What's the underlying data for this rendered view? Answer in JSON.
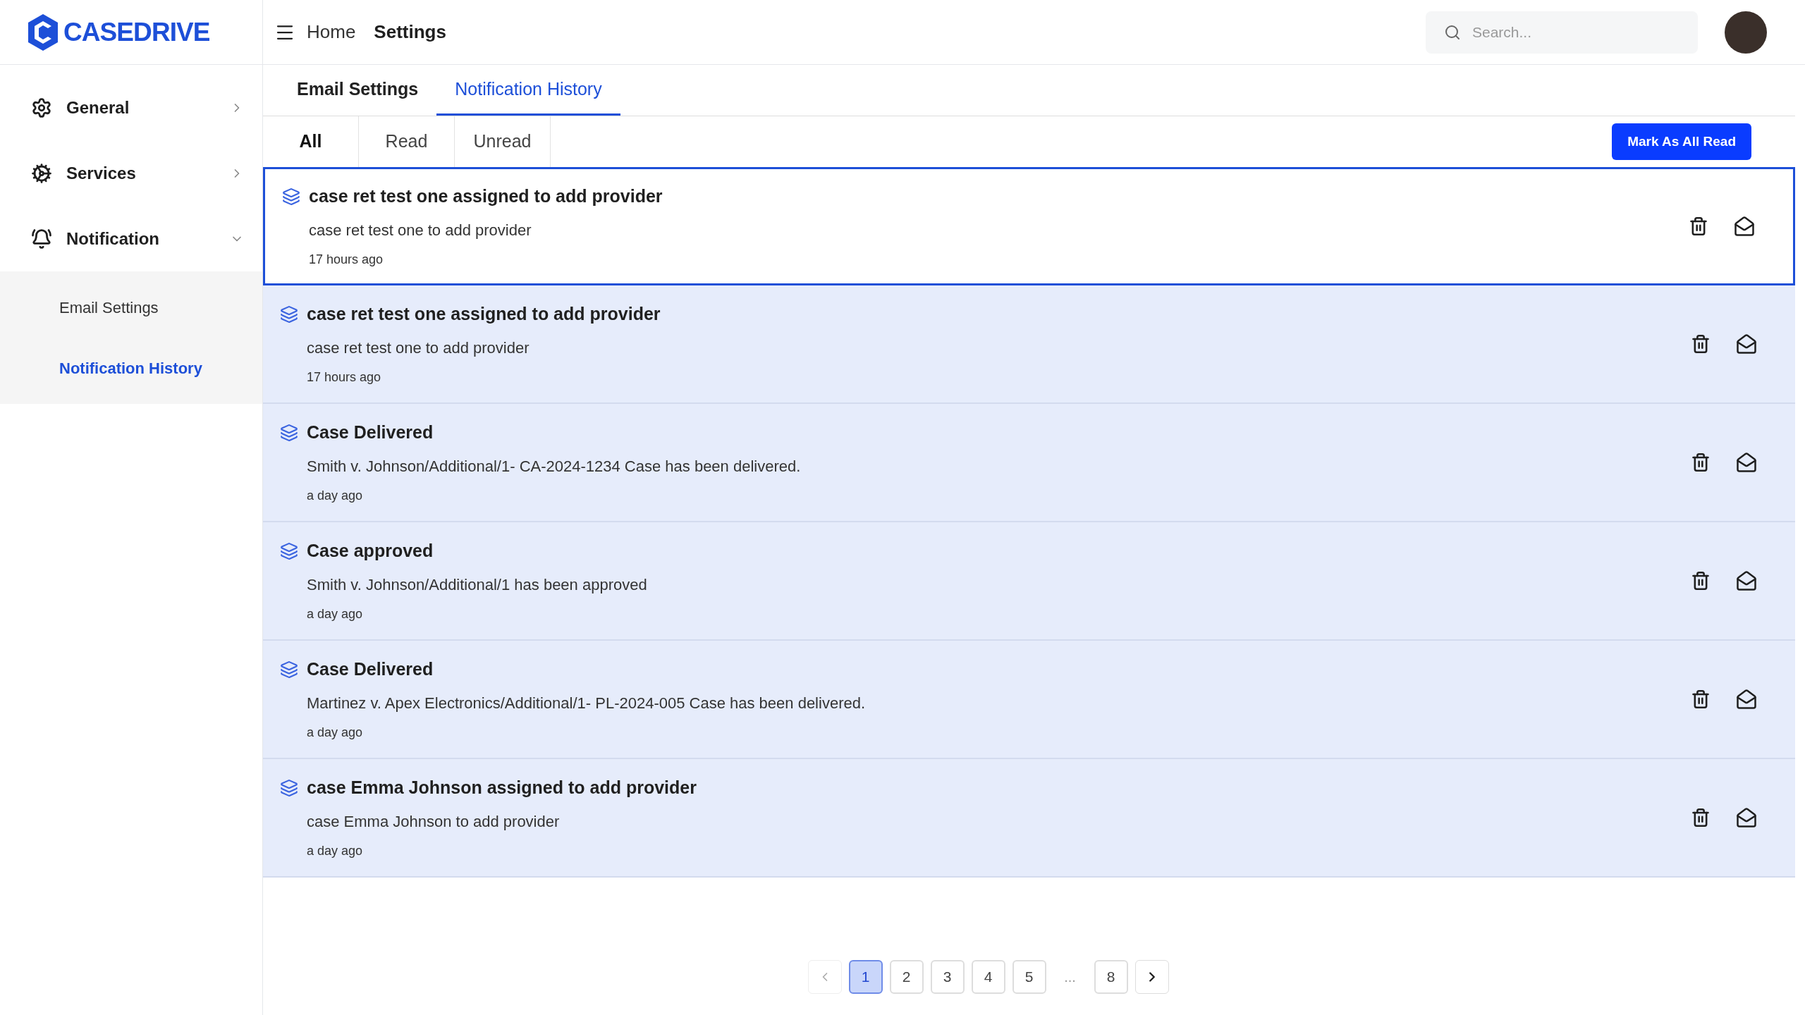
{
  "logo": {
    "text": "CASEDRIVE"
  },
  "sidebar": {
    "items": [
      {
        "label": "General",
        "kind": "gear",
        "expanded": false
      },
      {
        "label": "Services",
        "kind": "cog",
        "expanded": false
      },
      {
        "label": "Notification",
        "kind": "bell",
        "expanded": true,
        "children": [
          {
            "label": "Email Settings",
            "selected": false
          },
          {
            "label": "Notification History",
            "selected": true
          }
        ]
      }
    ]
  },
  "header": {
    "breadcrumb": [
      "Home",
      "Settings"
    ],
    "search": {
      "placeholder": "Search..."
    }
  },
  "tabs": [
    {
      "label": "Email Settings",
      "selected": false
    },
    {
      "label": "Notification History",
      "selected": true
    }
  ],
  "filters": [
    {
      "label": "All",
      "selected": true
    },
    {
      "label": "Read",
      "selected": false
    },
    {
      "label": "Unread",
      "selected": false
    }
  ],
  "mark_all_button": "Mark As All Read",
  "notifications": [
    {
      "title": "case ret test one assigned to add provider",
      "body": "case ret test one to add provider",
      "time": "17 hours ago",
      "selected": true
    },
    {
      "title": "case ret test one assigned to add provider",
      "body": "case ret test one to add provider",
      "time": "17 hours ago",
      "selected": false
    },
    {
      "title": "Case Delivered",
      "body": "Smith v. Johnson/Additional/1- CA-2024-1234 Case has been delivered.",
      "time": "a day ago",
      "selected": false
    },
    {
      "title": "Case approved",
      "body": "Smith v. Johnson/Additional/1 has been approved",
      "time": "a day ago",
      "selected": false
    },
    {
      "title": "Case Delivered",
      "body": "Martinez v. Apex Electronics/Additional/1- PL-2024-005 Case has been delivered.",
      "time": "a day ago",
      "selected": false
    },
    {
      "title": "case Emma Johnson assigned to add provider",
      "body": "case Emma Johnson to add provider",
      "time": "a day ago",
      "selected": false
    }
  ],
  "pagination": {
    "pages": [
      {
        "label": "1",
        "selected": true
      },
      {
        "label": "2",
        "selected": false
      },
      {
        "label": "3",
        "selected": false
      },
      {
        "label": "4",
        "selected": false
      },
      {
        "label": "5",
        "selected": false
      },
      {
        "label": "...",
        "kind": "ellipsis"
      },
      {
        "label": "8",
        "selected": false
      }
    ]
  }
}
